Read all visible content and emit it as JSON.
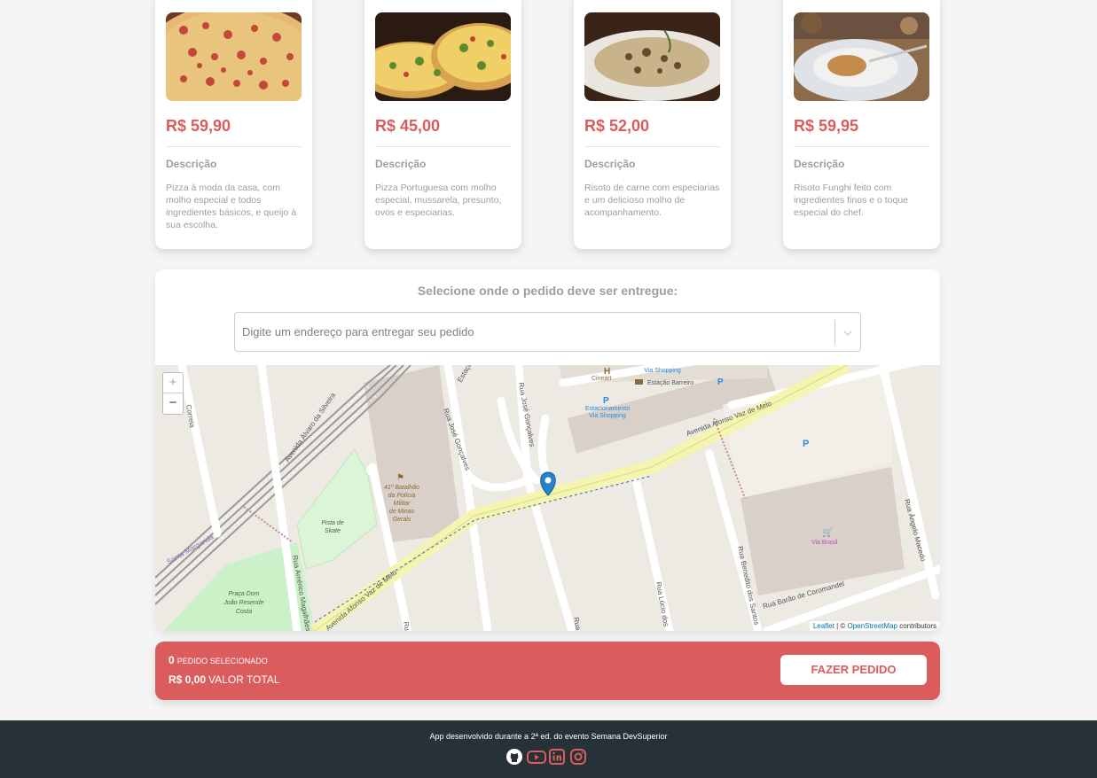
{
  "products": [
    {
      "price": "R$ 59,90",
      "desc_title": "Descrição",
      "description": "Pizza à moda da casa, com molho especial e todos ingredientes básicos, e queijo à sua escolha.",
      "image": "pizza-calabresa-image"
    },
    {
      "price": "R$ 45,00",
      "desc_title": "Descrição",
      "description": "Pizza Portuguesa com molho especial, mussarela, presunto, ovos e especiarias.",
      "image": "pizza-portuguesa-image"
    },
    {
      "price": "R$ 52,00",
      "desc_title": "Descrição",
      "description": "Risoto de carne com especiarias e um delicioso molho de acompanhamento.",
      "image": "risoto-carne-image"
    },
    {
      "price": "R$ 59,95",
      "desc_title": "Descrição",
      "description": "Risoto Funghi feito com ingredientes finos e o toque especial do chef.",
      "image": "risoto-funghi-image"
    }
  ],
  "address": {
    "title": "Selecione onde o pedido deve ser entregue:",
    "placeholder": "Digite um endereço para entregar seu pedido"
  },
  "map": {
    "zoom_in": "+",
    "zoom_out": "−",
    "attribution_leaflet": "Leaflet",
    "attribution_sep": " | © ",
    "attribution_osm": "OpenStreetMap",
    "attribution_tail": " contributors",
    "labels": {
      "av_alvaro": "Avenida Álvaro da Silveira",
      "rua_jose_goncalves_1": "Rua José Gonçalves",
      "rua_jose_goncalves_2": "Rua José Gonçalves",
      "av_afonso_1": "Avenida Afonso Vaz de Melo",
      "av_afonso_2": "Avenida Afonso Vaz de Melo",
      "batalhao": [
        "41º Batalhão",
        "da Polícia",
        "Militar",
        "de Minas",
        "Gerais"
      ],
      "pista": [
        "Pista de",
        "Skate"
      ],
      "praca": [
        "Praça Dom",
        "João Resende",
        "Costa"
      ],
      "rua_americo": "Rua Américo Magalhães",
      "rua_lucio": "Rua Lúcio dos",
      "rua_benedito": "Rua Benedito dos Santos",
      "rua_barao": "Rua Barão de Coromandel",
      "rua_angelo": "Rua Ângelo Macedo",
      "via_brasil": "Via Brasil",
      "estacionamento": [
        "Estacionamento",
        "Via Shopping"
      ],
      "estacao_barreiro": "Estação Barreiro",
      "cineart": "Cineart",
      "via_shopping": "Via Shopping",
      "santa_margarida": "Santa Margarida",
      "correia": "Correia",
      "estacao": "Estação",
      "rua_short": "Rua",
      "rua_short2": "Rua"
    }
  },
  "summary": {
    "count": "0",
    "count_label": "PEDIDO SELECIONADO",
    "total": "R$ 0,00",
    "total_label": "VALOR TOTAL",
    "button": "FAZER PEDIDO"
  },
  "footer": {
    "text": "App desenvolvido durante a 2ª ed. do evento Semana DevSuperior",
    "icons": [
      "github-icon",
      "youtube-icon",
      "linkedin-icon",
      "instagram-icon"
    ]
  },
  "colors": {
    "accent": "#DA5C5C",
    "footer_bg": "#263238"
  }
}
